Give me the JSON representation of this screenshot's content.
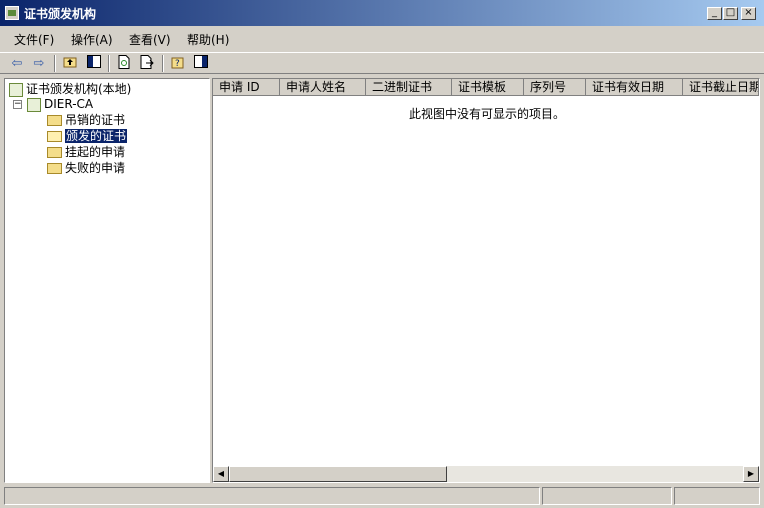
{
  "window": {
    "title": "证书颁发机构",
    "controls": {
      "minimize": "_",
      "maximize": "□",
      "close": "×"
    }
  },
  "menubar": {
    "items": [
      {
        "label": "文件(F)"
      },
      {
        "label": "操作(A)"
      },
      {
        "label": "查看(V)"
      },
      {
        "label": "帮助(H)"
      }
    ]
  },
  "toolbar": {
    "back": "⇦",
    "forward": "⇨"
  },
  "tree": {
    "root": "证书颁发机构(本地)",
    "ca": "DIER-CA",
    "expander": "−",
    "folders": [
      {
        "label": "吊销的证书"
      },
      {
        "label": "颁发的证书"
      },
      {
        "label": "挂起的申请"
      },
      {
        "label": "失败的申请"
      }
    ]
  },
  "list": {
    "columns": [
      "申请 ID",
      "申请人姓名",
      "二进制证书",
      "证书模板",
      "序列号",
      "证书有效日期",
      "证书截止日期"
    ],
    "empty_message": "此视图中没有可显示的项目。"
  },
  "scrollbar": {
    "left": "◀",
    "right": "▶"
  }
}
